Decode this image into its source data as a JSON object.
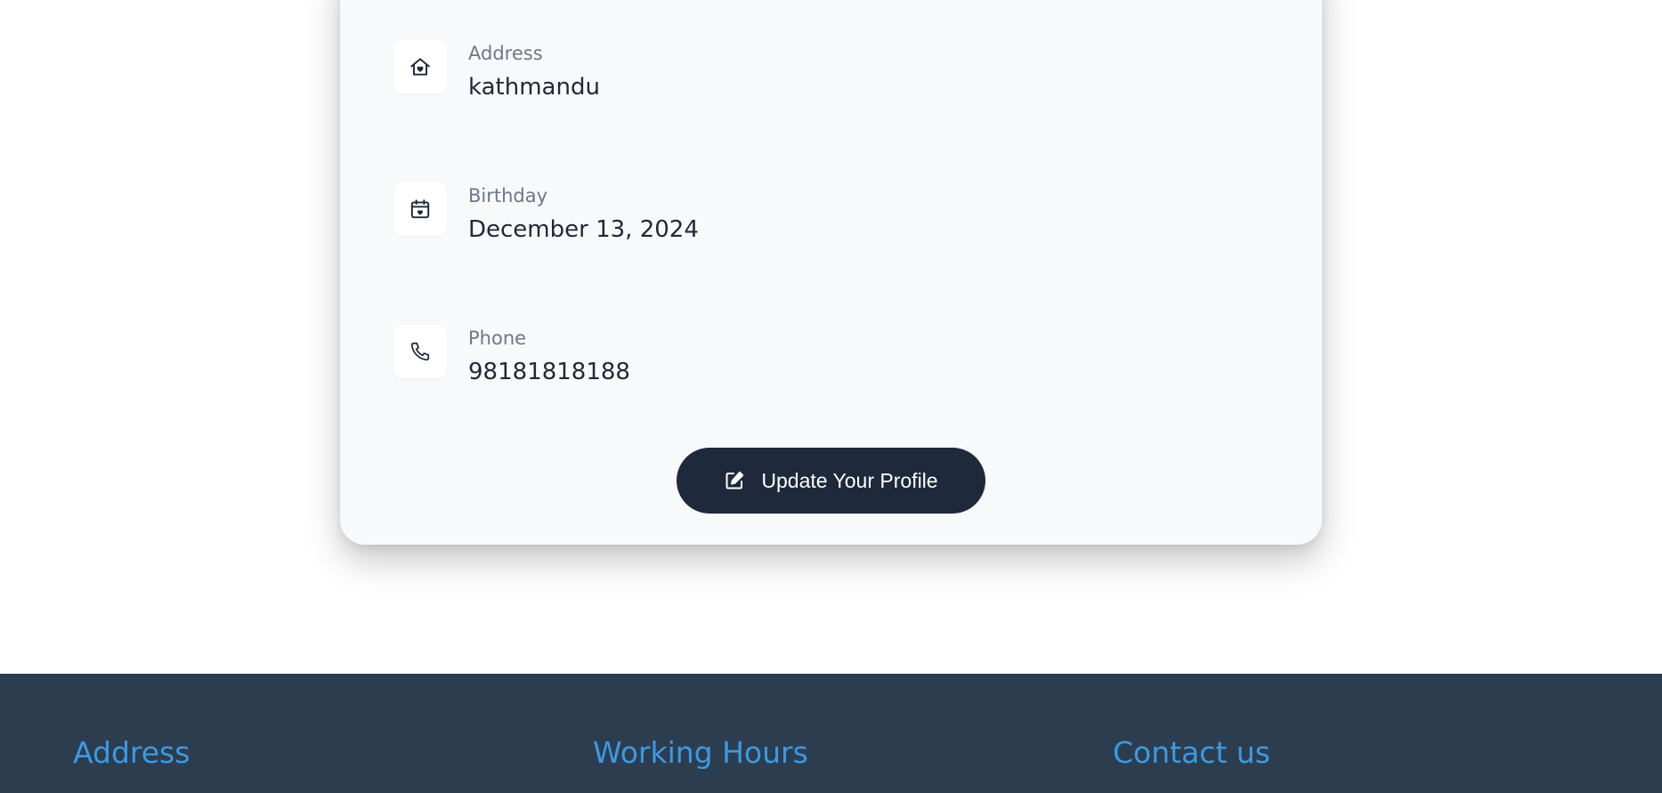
{
  "profile": {
    "address": {
      "label": "Address",
      "value": "kathmandu",
      "icon": "house-heart-icon"
    },
    "birthday": {
      "label": "Birthday",
      "value": "December 13, 2024",
      "icon": "calendar-heart-icon"
    },
    "phone": {
      "label": "Phone",
      "value": "98181818188",
      "icon": "phone-icon"
    },
    "update_button": {
      "label": "Update Your Profile",
      "icon": "edit-icon"
    }
  },
  "footer": {
    "headings": {
      "address": "Address",
      "working_hours": "Working Hours",
      "contact": "Contact us"
    }
  },
  "colors": {
    "card_bg": "#f8f9fb",
    "button_bg": "#1e293b",
    "footer_bg": "#2d3d50",
    "footer_heading": "#3b9ae1",
    "label": "#6b7889",
    "value": "#1f2937"
  }
}
